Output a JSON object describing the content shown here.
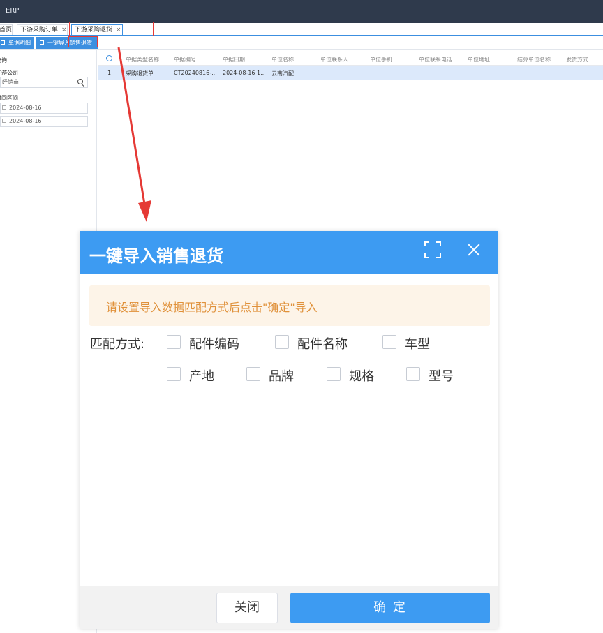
{
  "app": {
    "title": "ERP"
  },
  "tabs": [
    {
      "label": "首页"
    },
    {
      "label": "下游采购订单",
      "close": "×"
    },
    {
      "label": "下游采购退货",
      "close": "×"
    }
  ],
  "toolbar": {
    "detail_label": "单据明细",
    "import_prefix": "一键导入",
    "import_highlight": "销售退货"
  },
  "filter": {
    "section_title": "查询",
    "company_label": "下游公司",
    "company_value": "经销商",
    "date_range_label": "时间区间",
    "date_from": "2024-08-16",
    "date_to": "2024-08-16"
  },
  "grid": {
    "columns": [
      "单据类型名称",
      "单据编号",
      "单据日期",
      "单位名称",
      "单位联系人",
      "单位手机",
      "单位联系电话",
      "单位地址",
      "结算单位名称",
      "发货方式"
    ],
    "rows": [
      {
        "index": "1",
        "type": "采购退货单",
        "number": "CT20240816-...",
        "date": "2024-08-16 1...",
        "unit": "云南汽配"
      }
    ]
  },
  "dialog": {
    "title": "一键导入销售退货",
    "tip": "请设置导入数据匹配方式后点击\"确定\"导入",
    "match_label": "匹配方式:",
    "options": [
      "配件编码",
      "配件名称",
      "车型",
      "产地",
      "品牌",
      "规格",
      "型号"
    ],
    "close_button": "关闭",
    "ok_button": "确 定"
  },
  "colors": {
    "topbar": "#2f3a4c",
    "accent": "#3d9bf2",
    "highlight": "#e53935",
    "tip_bg": "#fdf4e8",
    "tip_text": "#e0913a",
    "selected_row": "#dce9fb"
  }
}
